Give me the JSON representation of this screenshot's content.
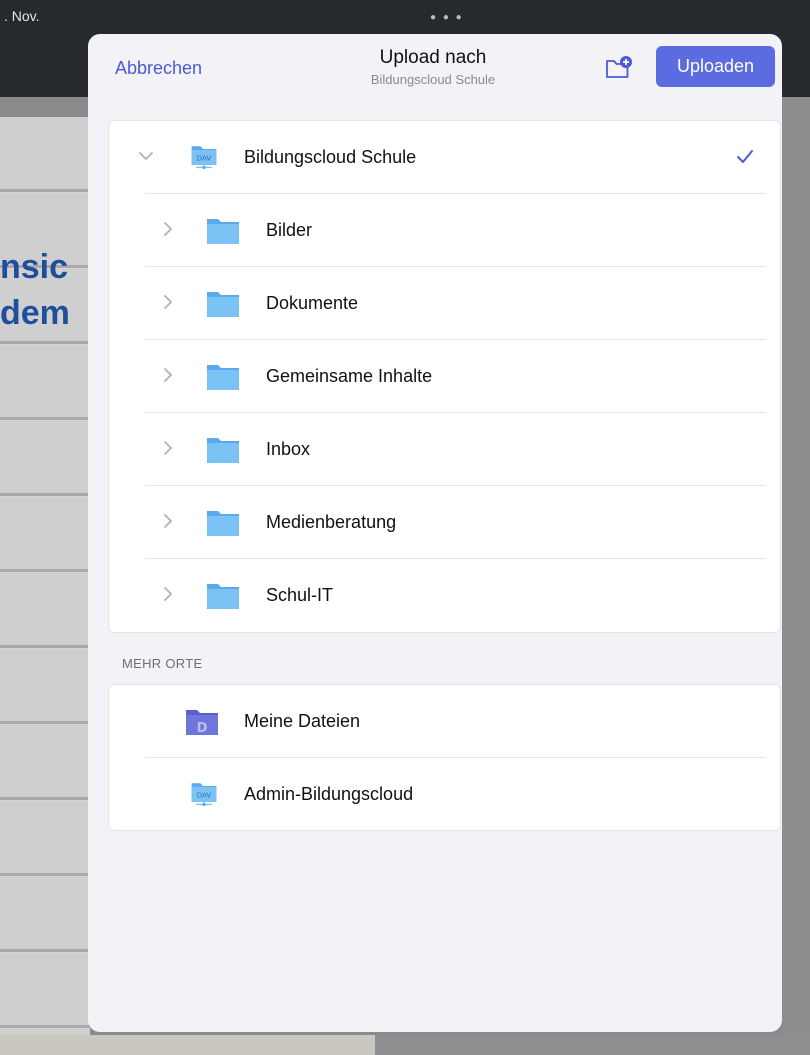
{
  "background": {
    "status_time": ". Nov.",
    "fragment_line1": "nsic",
    "fragment_line2": "dem"
  },
  "header": {
    "cancel_label": "Abbrechen",
    "title": "Upload nach",
    "subtitle": "Bildungscloud Schule",
    "new_folder_icon": "folder-plus-icon",
    "upload_label": "Uploaden"
  },
  "tree": {
    "root": {
      "label": "Bildungscloud Schule",
      "icon": "webdav-folder-icon",
      "expanded": true,
      "selected": true
    },
    "folders": [
      {
        "label": "Bilder",
        "icon": "folder-icon"
      },
      {
        "label": "Dokumente",
        "icon": "folder-icon"
      },
      {
        "label": "Gemeinsame Inhalte",
        "icon": "folder-icon"
      },
      {
        "label": "Inbox",
        "icon": "folder-icon"
      },
      {
        "label": "Medienberatung",
        "icon": "folder-icon"
      },
      {
        "label": "Schul-IT",
        "icon": "folder-icon"
      }
    ]
  },
  "more_places": {
    "header": "MEHR ORTE",
    "items": [
      {
        "label": "Meine Dateien",
        "icon": "my-files-folder-icon"
      },
      {
        "label": "Admin-Bildungscloud",
        "icon": "webdav-folder-icon"
      }
    ]
  },
  "colors": {
    "accent": "#5b6be0",
    "link": "#4b5bd6",
    "folder": "#7cc3f5",
    "my_files_folder": "#6f76d9"
  }
}
